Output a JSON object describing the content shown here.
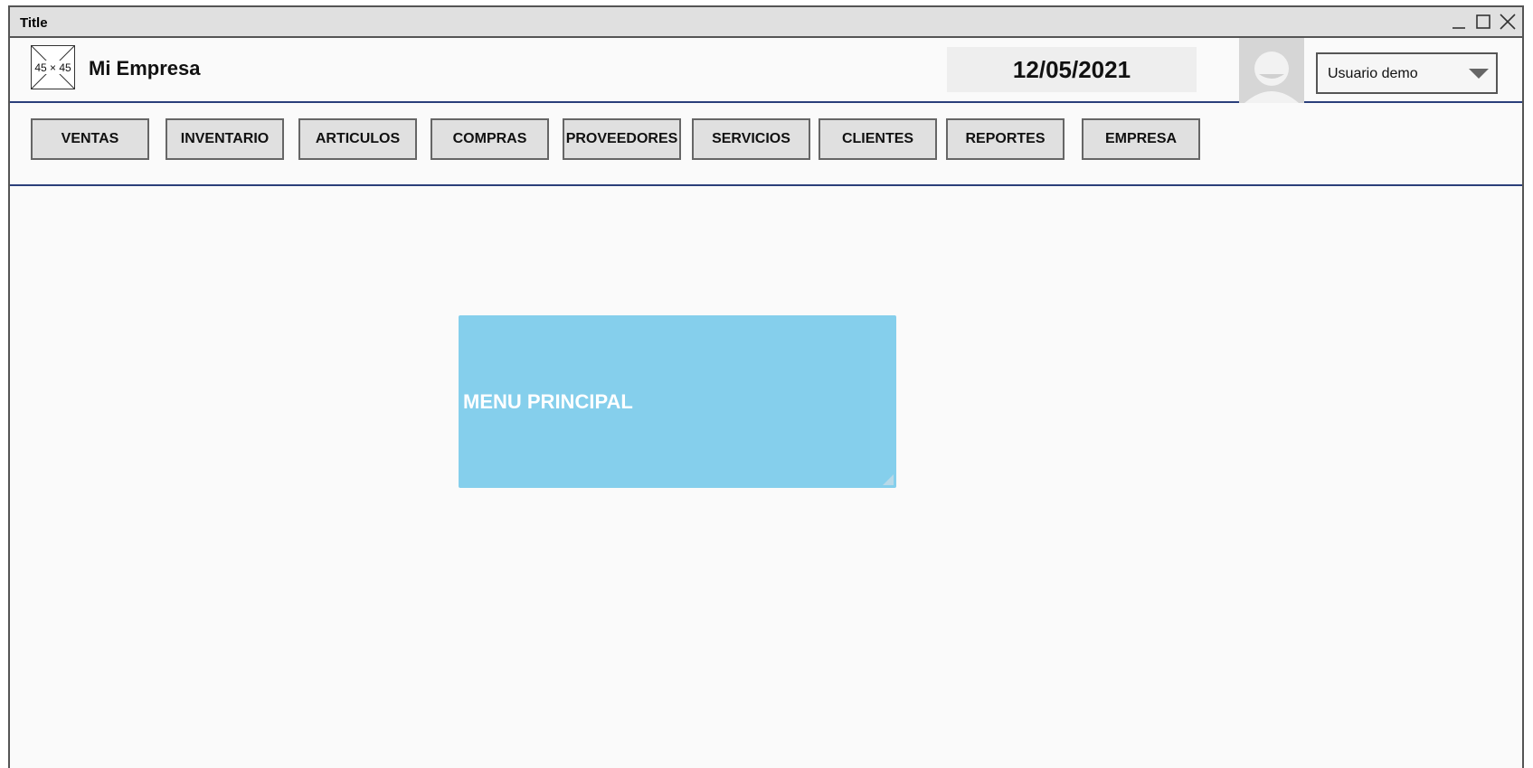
{
  "window": {
    "title": "Title"
  },
  "header": {
    "logo_placeholder": "45 × 45",
    "company_name": "Mi Empresa",
    "date": "12/05/2021",
    "user_select": {
      "selected": "Usuario demo"
    }
  },
  "nav": {
    "buttons": [
      {
        "label": "VENTAS"
      },
      {
        "label": "INVENTARIO"
      },
      {
        "label": "ARTICULOS"
      },
      {
        "label": "COMPRAS"
      },
      {
        "label": "PROVEEDORES"
      },
      {
        "label": "SERVICIOS"
      },
      {
        "label": "CLIENTES"
      },
      {
        "label": "REPORTES"
      },
      {
        "label": "EMPRESA"
      }
    ]
  },
  "main": {
    "panel_label": "MENU PRINCIPAL"
  },
  "colors": {
    "accent_line": "#2a3f7a",
    "panel": "#85cfec"
  }
}
